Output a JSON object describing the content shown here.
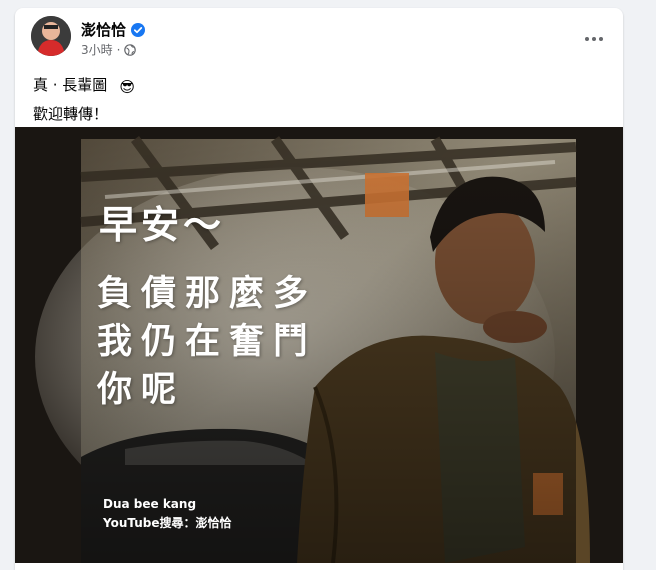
{
  "post": {
    "author": "澎恰恰",
    "time": "3小時",
    "separator": "·",
    "text_line1": "真 · 長輩圖",
    "text_line2": "歡迎轉傳！",
    "emoji": "😎"
  },
  "image": {
    "headline": "早安～",
    "slogan_line1": "負債那麼多",
    "slogan_line2": "我仍在奮鬥",
    "slogan_line3": "你呢",
    "caption_line1": "Dua bee kang",
    "caption_line2": "YouTube搜尋：澎恰恰"
  },
  "icons": {
    "verified": "verified-badge-icon",
    "privacy": "globe-icon",
    "more": "more-options-icon"
  },
  "colors": {
    "verified_blue": "#1877f2",
    "accent_orange": "#e8833a",
    "meta_gray": "#65676b"
  }
}
